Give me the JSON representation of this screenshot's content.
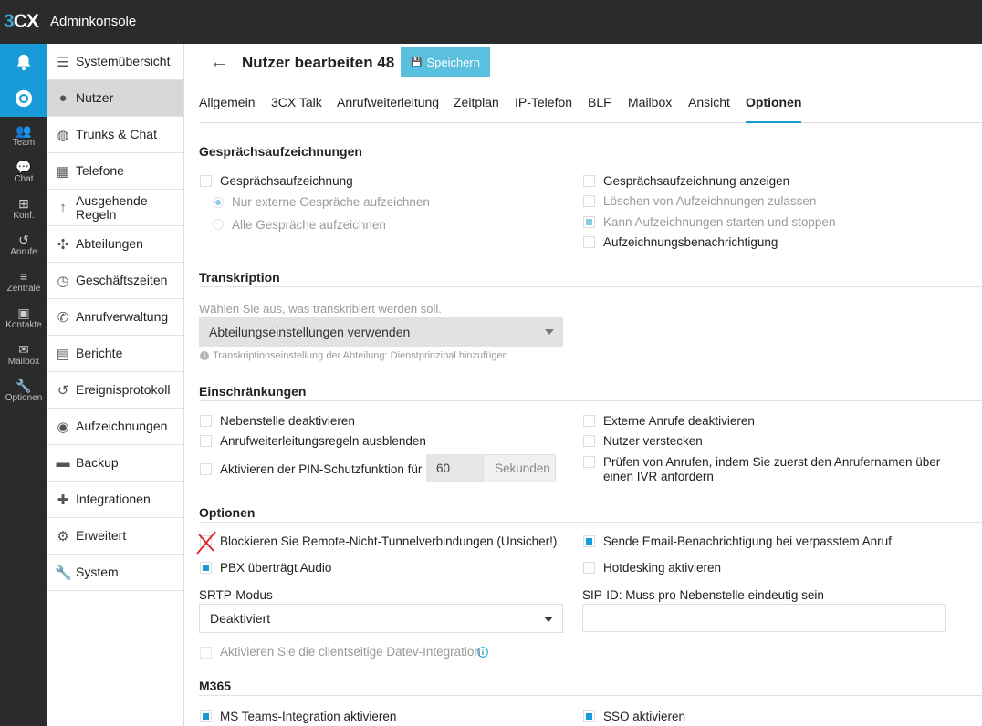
{
  "app": {
    "logo_3": "3",
    "logo_cx": "CX",
    "title": "Adminkonsole"
  },
  "rail": {
    "items": [
      {
        "icon": "team-icon",
        "glyph": "👥",
        "label": "Team"
      },
      {
        "icon": "chat-icon",
        "glyph": "💬",
        "label": "Chat"
      },
      {
        "icon": "conference-icon",
        "glyph": "⊞",
        "label": "Konf."
      },
      {
        "icon": "history-icon",
        "glyph": "↺",
        "label": "Anrufe"
      },
      {
        "icon": "dashboard-icon",
        "glyph": "≡",
        "label": "Zentrale"
      },
      {
        "icon": "contacts-icon",
        "glyph": "▣",
        "label": "Kontakte"
      },
      {
        "icon": "mailbox-icon",
        "glyph": "✉",
        "label": "Mailbox"
      },
      {
        "icon": "wrench-icon",
        "glyph": "🔧",
        "label": "Optionen"
      }
    ]
  },
  "nav": {
    "items": [
      {
        "icon": "dashboard-icon",
        "glyph": "☰",
        "label": "Systemübersicht"
      },
      {
        "icon": "user-icon",
        "glyph": "●",
        "label": "Nutzer"
      },
      {
        "icon": "globe-icon",
        "glyph": "◍",
        "label": "Trunks & Chat"
      },
      {
        "icon": "phone-grid-icon",
        "glyph": "▦",
        "label": "Telefone"
      },
      {
        "icon": "arrow-up-icon",
        "glyph": "↑",
        "label": "Ausgehende Regeln"
      },
      {
        "icon": "group-icon",
        "glyph": "✣",
        "label": "Abteilungen"
      },
      {
        "icon": "clock-icon",
        "glyph": "◷",
        "label": "Geschäftszeiten"
      },
      {
        "icon": "phone-icon",
        "glyph": "✆",
        "label": "Anrufverwaltung"
      },
      {
        "icon": "report-icon",
        "glyph": "▤",
        "label": "Berichte"
      },
      {
        "icon": "history-icon",
        "glyph": "↺",
        "label": "Ereignisprotokoll"
      },
      {
        "icon": "record-icon",
        "glyph": "◉",
        "label": "Aufzeichnungen"
      },
      {
        "icon": "backup-icon",
        "glyph": "▬",
        "label": "Backup"
      },
      {
        "icon": "puzzle-icon",
        "glyph": "✚",
        "label": "Integrationen"
      },
      {
        "icon": "gear-icon",
        "glyph": "⚙",
        "label": "Erweitert"
      },
      {
        "icon": "wrench-icon",
        "glyph": "🔧",
        "label": "System"
      }
    ]
  },
  "header": {
    "back_glyph": "←",
    "title": "Nutzer bearbeiten 48",
    "save_label": "Speichern",
    "save_icon": "💾"
  },
  "tabs": [
    "Allgemein",
    "3CX Talk",
    "Anrufweiterleitung",
    "Zeitplan",
    "IP-Telefon",
    "BLF",
    "Mailbox",
    "Ansicht",
    "Optionen"
  ],
  "recording": {
    "title": "Gesprächsaufzeichnungen",
    "enable": "Gesprächsaufzeichnung",
    "radio_external": "Nur externe Gespräche aufzeichnen",
    "radio_all": "Alle Gespräche aufzeichnen",
    "show": "Gesprächsaufzeichnung anzeigen",
    "allow_delete": "Löschen von Aufzeichnungen zulassen",
    "start_stop": "Kann Aufzeichnungen starten und stoppen",
    "notify": "Aufzeichnungsbenachrichtigung"
  },
  "transcription": {
    "title": "Transkription",
    "help": "Wählen Sie aus, was transkribiert werden soll.",
    "select_value": "Abteilungseinstellungen verwenden",
    "note": "Transkriptionseinstellung der Abteilung: Dienstprinzipal hinzufügen"
  },
  "restrictions": {
    "title": "Einschränkungen",
    "disable_ext": "Nebenstelle deaktivieren",
    "hide_forward": "Anrufweiterleitungsregeln ausblenden",
    "pin": "Aktivieren der PIN-Schutzfunktion für",
    "pin_value": "60",
    "pin_unit": "Sekunden",
    "disable_external": "Externe Anrufe deaktivieren",
    "hide_user": "Nutzer verstecken",
    "screen_calls": "Prüfen von Anrufen, indem Sie zuerst den Anrufernamen über einen IVR anfordern"
  },
  "options": {
    "title": "Optionen",
    "block_remote": "Blockieren Sie Remote-Nicht-Tunnelverbindungen (Unsicher!)",
    "pbx_audio": "PBX überträgt Audio",
    "send_email": "Sende Email-Benachrichtigung bei verpasstem Anruf",
    "hotdesking": "Hotdesking aktivieren",
    "srtp_label": "SRTP-Modus",
    "srtp_value": "Deaktiviert",
    "sip_label": "SIP-ID: Muss pro Nebenstelle eindeutig sein",
    "sip_value": "",
    "datev": "Aktivieren Sie die clientseitige Datev-Integration"
  },
  "m365": {
    "title": "M365",
    "teams": "MS Teams-Integration aktivieren",
    "sso": "SSO aktivieren"
  },
  "colors": {
    "accent": "#189ad6",
    "save_button": "#5bc0de",
    "topbar": "#2b2b2b",
    "red_cross": "#e0222a"
  }
}
